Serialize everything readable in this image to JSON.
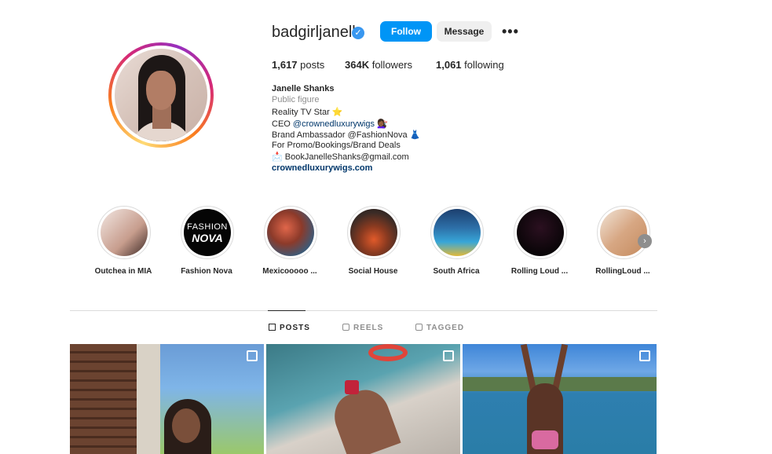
{
  "profile": {
    "username": "badgirljanelle",
    "verified_icon": "verified-badge-icon",
    "follow_label": "Follow",
    "message_label": "Message",
    "more_label": "•••",
    "stats": {
      "posts_value": "1,617",
      "posts_label": "posts",
      "followers_value": "364K",
      "followers_label": "followers",
      "following_value": "1,061",
      "following_label": "following"
    },
    "bio": {
      "name": "Janelle Shanks",
      "category": "Public figure",
      "line1": "Reality TV Star ⭐",
      "line2_prefix": "CEO ",
      "line2_link": "@crownedluxurywigs",
      "line2_suffix": " 💇🏾‍♀️",
      "line3": "Brand Ambassador @FashionNova 👗",
      "line4": "For Promo/Bookings/Brand Deals",
      "line5": "📩 BookJanelleShanks@gmail.com",
      "website": "crownedluxurywigs.com"
    }
  },
  "highlights": [
    {
      "label": "Outchea in MIA"
    },
    {
      "label": "Fashion Nova",
      "text_top": "FASHION",
      "text_bottom": "NOVA"
    },
    {
      "label": "Mexicooooo ..."
    },
    {
      "label": "Social House"
    },
    {
      "label": "South Africa"
    },
    {
      "label": "Rolling Loud ..."
    },
    {
      "label": "RollingLoud ..."
    }
  ],
  "highlights_next_icon": "chevron-right-icon",
  "tabs": [
    {
      "label": "POSTS",
      "active": true,
      "icon": "grid-icon"
    },
    {
      "label": "REELS",
      "active": false,
      "icon": "reels-icon"
    },
    {
      "label": "TAGGED",
      "active": false,
      "icon": "tagged-icon"
    }
  ],
  "colors": {
    "accent_blue": "#0095f6",
    "link_blue": "#00376b",
    "text_primary": "#262626",
    "text_secondary": "#8e8e8e"
  }
}
